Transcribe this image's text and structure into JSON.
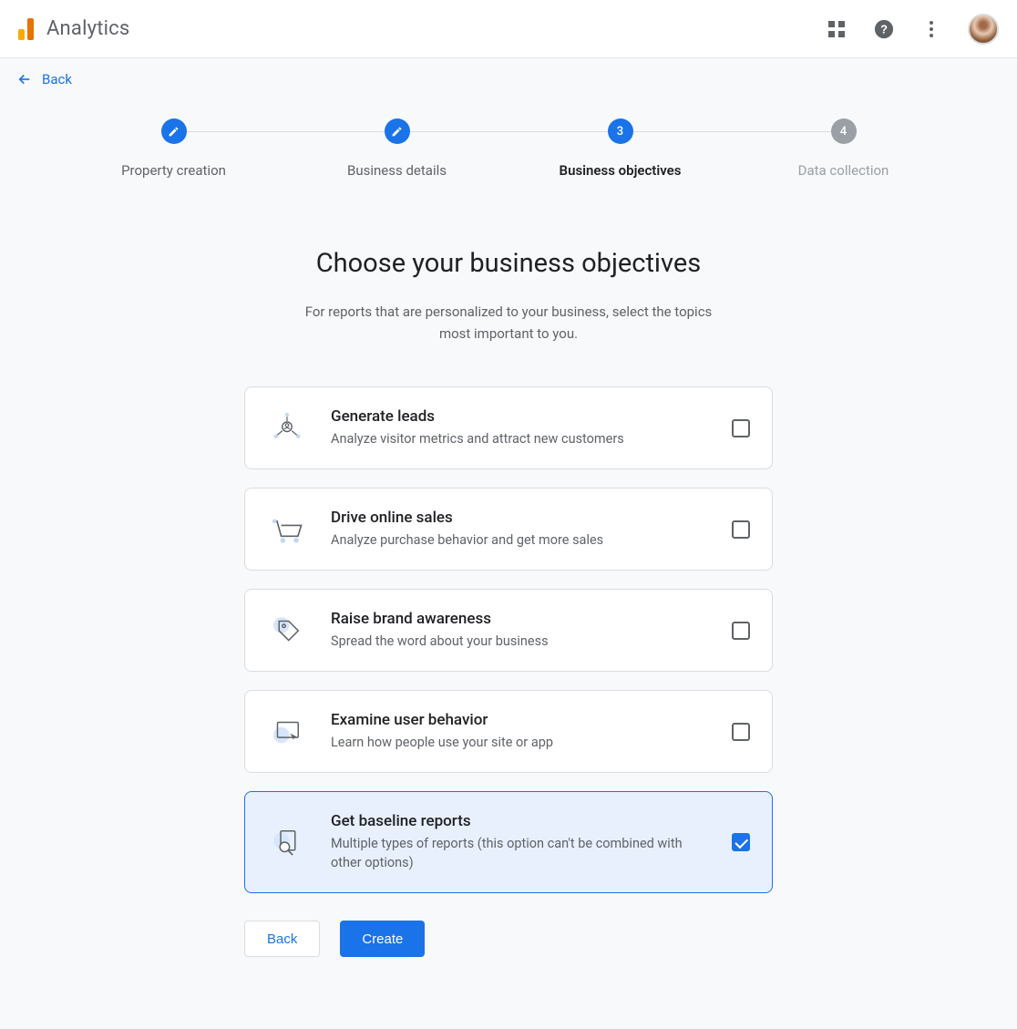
{
  "appbar": {
    "title": "Analytics"
  },
  "nav": {
    "back_label": "Back"
  },
  "stepper": {
    "steps": [
      {
        "label": "Property creation",
        "badge": "pencil",
        "active": false
      },
      {
        "label": "Business details",
        "badge": "pencil",
        "active": false
      },
      {
        "label": "Business objectives",
        "badge": "3",
        "active": true
      },
      {
        "label": "Data collection",
        "badge": "4",
        "active": false,
        "disabled": true
      }
    ]
  },
  "heading": {
    "title": "Choose your business objectives",
    "subtitle": "For reports that are personalized to your business, select the topics most important to you."
  },
  "objectives": [
    {
      "key": "leads",
      "title": "Generate leads",
      "subtitle": "Analyze visitor metrics and attract new customers",
      "checked": false
    },
    {
      "key": "sales",
      "title": "Drive online sales",
      "subtitle": "Analyze purchase behavior and get more sales",
      "checked": false
    },
    {
      "key": "brand",
      "title": "Raise brand awareness",
      "subtitle": "Spread the word about your business",
      "checked": false
    },
    {
      "key": "behavior",
      "title": "Examine user behavior",
      "subtitle": "Learn how people use your site or app",
      "checked": false
    },
    {
      "key": "baseline",
      "title": "Get baseline reports",
      "subtitle": "Multiple types of reports (this option can't be combined with other options)",
      "checked": true
    }
  ],
  "footer": {
    "back_label": "Back",
    "create_label": "Create"
  },
  "colors": {
    "primary": "#1a73e8",
    "muted": "#5f6368",
    "selected_bg": "#e8f0fe"
  }
}
